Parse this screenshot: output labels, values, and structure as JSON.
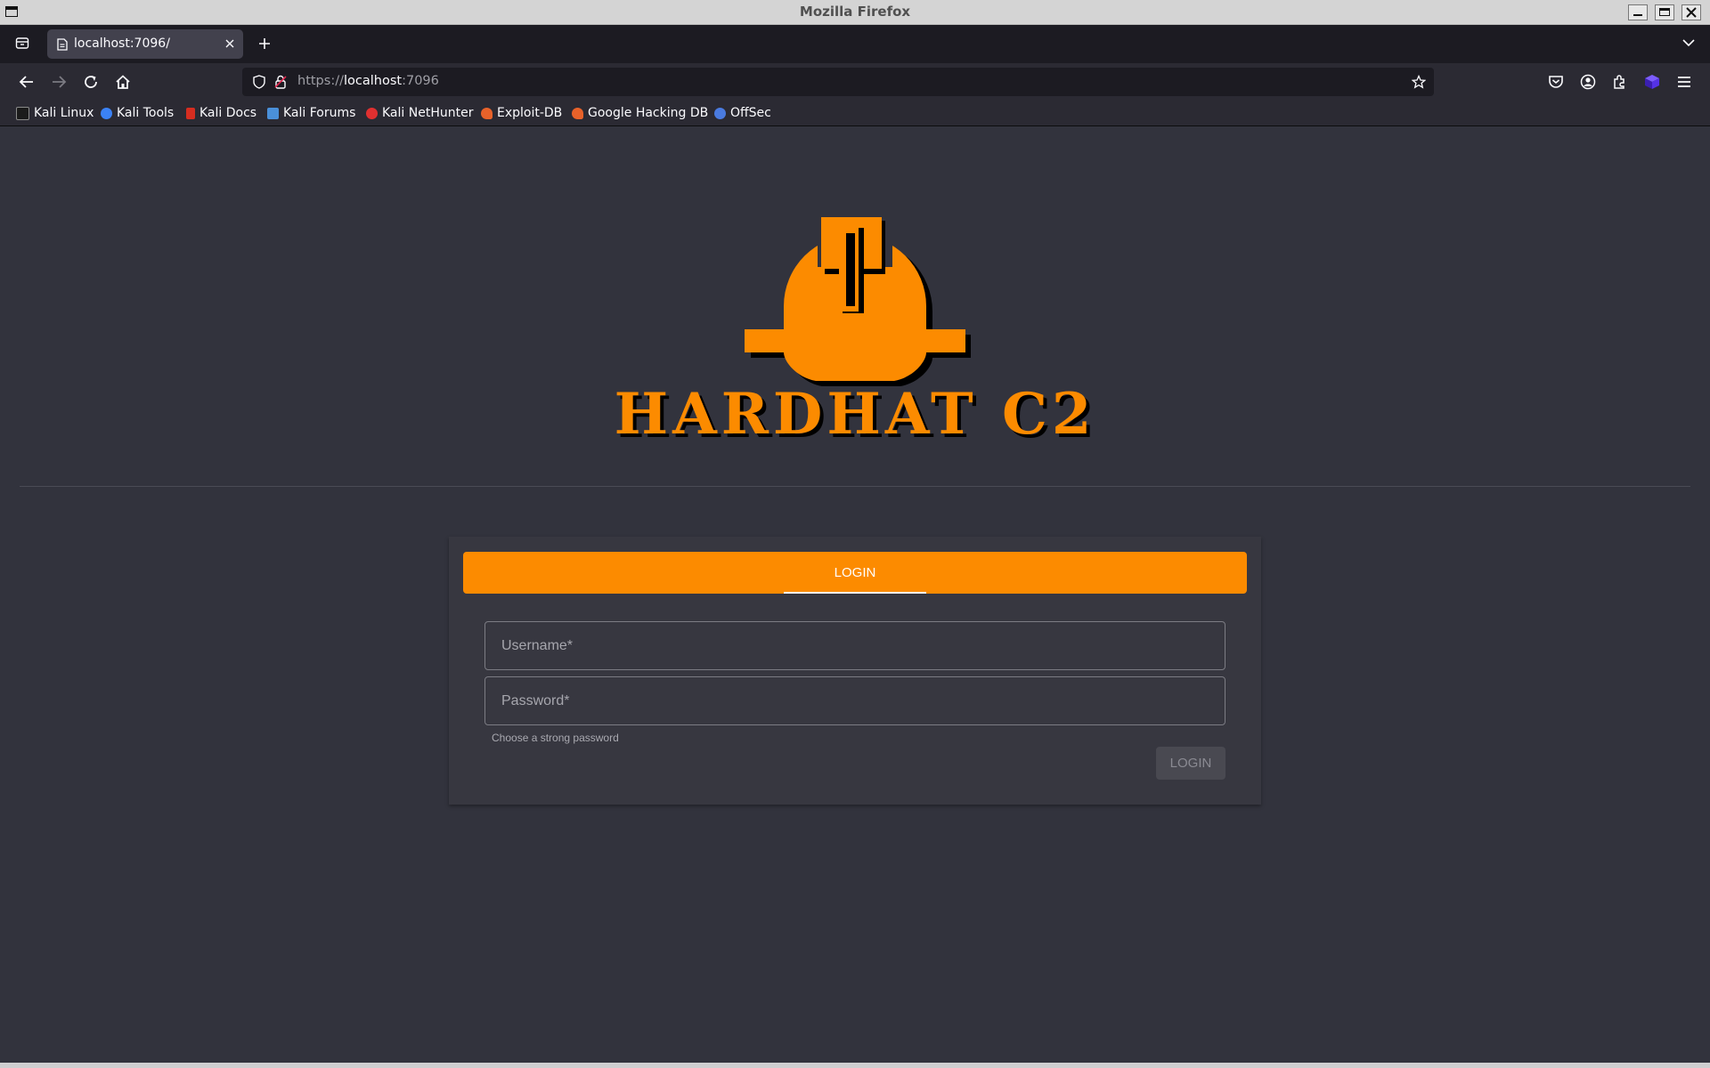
{
  "window": {
    "title": "Mozilla Firefox"
  },
  "tabs": [
    {
      "label": "localhost:7096/",
      "active": true
    }
  ],
  "url": {
    "scheme": "https://",
    "host": "localhost",
    "port": ":7096"
  },
  "bookmarks": [
    {
      "label": "Kali Linux",
      "icon": "kali-linux-icon",
      "color": "#1b1b1b"
    },
    {
      "label": "Kali Tools",
      "icon": "kali-tools-icon",
      "color": "#3b82f6"
    },
    {
      "label": "Kali Docs",
      "icon": "kali-docs-icon",
      "color": "#d62d20"
    },
    {
      "label": "Kali Forums",
      "icon": "kali-forums-icon",
      "color": "#4a90d9"
    },
    {
      "label": "Kali NetHunter",
      "icon": "kali-nethunter-icon",
      "color": "#e03030"
    },
    {
      "label": "Exploit-DB",
      "icon": "exploit-db-icon",
      "color": "#e8622a"
    },
    {
      "label": "Google Hacking DB",
      "icon": "ghdb-icon",
      "color": "#e8622a"
    },
    {
      "label": "OffSec",
      "icon": "offsec-icon",
      "color": "#4a7be0"
    }
  ],
  "brand": {
    "name": "HARDHAT C2",
    "accent": "#fc8b00"
  },
  "login": {
    "tab_label": "LOGIN",
    "username_placeholder": "Username*",
    "password_placeholder": "Password*",
    "helper_text": "Choose a strong password",
    "submit_label": "LOGIN"
  }
}
